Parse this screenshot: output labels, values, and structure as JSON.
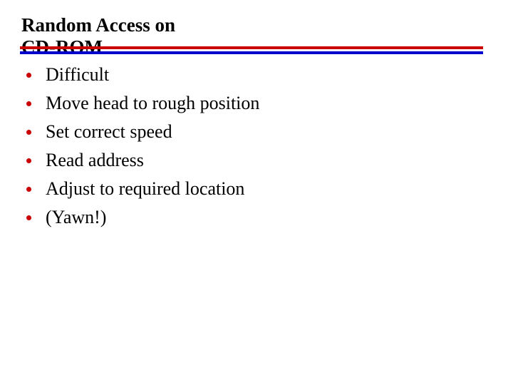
{
  "slide": {
    "title_line_1": "Random Access on",
    "title_line_2": "CD-ROM",
    "title_full": "Random Access on\nCD-ROM",
    "background_color": "#ffffff",
    "title_color": "#000000"
  },
  "divider": {
    "top_rule_color": "#cc0000",
    "bottom_rule_color": "#0000cc"
  },
  "bullets": {
    "marker_color": "#cc0000",
    "text_color": "#000000",
    "items": [
      {
        "label": "Difficult"
      },
      {
        "label": "Move head to rough position"
      },
      {
        "label": "Set correct speed"
      },
      {
        "label": "Read address"
      },
      {
        "label": "Adjust to required location"
      },
      {
        "label": "(Yawn!)"
      }
    ]
  }
}
